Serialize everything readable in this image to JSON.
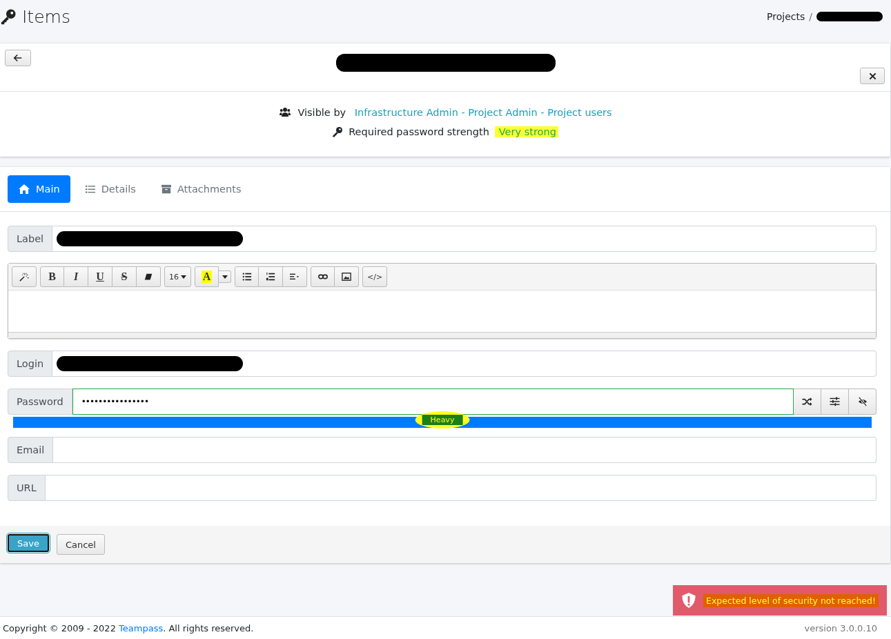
{
  "header": {
    "title": "Items",
    "breadcrumb": "Projects",
    "breadcrumb_separator": "/",
    "breadcrumb_redacted": true
  },
  "item": {
    "title_redacted": true,
    "visibility_label": "Visible by",
    "visible_by": "Infrastructure Admin - Project Admin - Project users",
    "strength_label": "Required password strength",
    "strength_required": "Very strong"
  },
  "tabs": [
    {
      "label": "Main",
      "kind": "home",
      "selected": true
    },
    {
      "label": "Details",
      "kind": "list",
      "selected": false
    },
    {
      "label": "Attachments",
      "kind": "archive",
      "selected": false
    }
  ],
  "fields": [
    {
      "kind": "text",
      "label": "Label",
      "redacted": true
    },
    {
      "kind": "editor",
      "toolbar": [
        {
          "buttons": [
            {
              "kind": "wand"
            }
          ]
        },
        {
          "buttons": [
            {
              "kind": "bold",
              "text": "B"
            },
            {
              "kind": "italic",
              "text": "I"
            },
            {
              "kind": "underline",
              "text": "U"
            },
            {
              "kind": "strike",
              "text": "S"
            },
            {
              "kind": "eraser"
            }
          ]
        },
        {
          "buttons": [
            {
              "kind": "size",
              "text": "16"
            }
          ]
        },
        {
          "buttons": [
            {
              "kind": "color",
              "text": "A"
            }
          ]
        },
        {
          "buttons": [
            {
              "kind": "ul"
            },
            {
              "kind": "ol"
            },
            {
              "kind": "align"
            }
          ]
        },
        {
          "buttons": [
            {
              "kind": "link"
            },
            {
              "kind": "image"
            }
          ]
        },
        {
          "buttons": [
            {
              "kind": "code",
              "text": "</>"
            }
          ]
        }
      ]
    },
    {
      "kind": "text",
      "label": "Login",
      "redacted": true
    },
    {
      "kind": "password",
      "label": "Password",
      "value": "••••••••••••••••",
      "strength": {
        "label": "Heavy",
        "level": 1
      }
    },
    {
      "kind": "text",
      "label": "Email"
    },
    {
      "kind": "text",
      "label": "URL"
    }
  ],
  "buttons": [
    {
      "label": "Save",
      "kind": "primary"
    },
    {
      "label": "Cancel",
      "kind": "default"
    }
  ],
  "toast": {
    "message": "Expected level of security not reached!"
  },
  "footer": {
    "copyright": "Copyright © 2009 - 2022 ",
    "link": "Teampass",
    "rest": ". All rights reserved.",
    "version": "version 3.0.0.10"
  }
}
